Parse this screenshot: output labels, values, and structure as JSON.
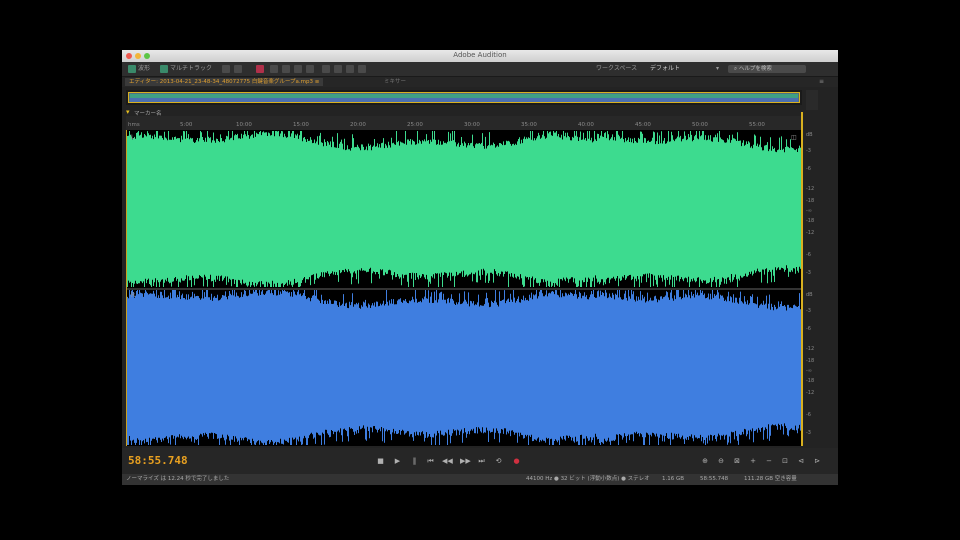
{
  "app": {
    "title": "Adobe Audition"
  },
  "toolbar": {
    "waveform_label": "波形",
    "multitrack_label": "マルチトラック",
    "workspace_label": "ワークスペース",
    "workspace_value": "デフォルト",
    "search_placeholder": "ヘルプを検索"
  },
  "tabs": [
    {
      "label": "エディター: 2013-04-21_23-48-34_48072775 白鍵音楽グループa.mp3 ≡"
    },
    {
      "label": "ミキサー"
    }
  ],
  "ruler": {
    "marker_label": "マーカー名",
    "ticks": [
      "hms",
      "5:00",
      "10:00",
      "15:00",
      "20:00",
      "25:00",
      "30:00",
      "35:00",
      "40:00",
      "45:00",
      "50:00",
      "55:00"
    ]
  },
  "channels": {
    "left": "L",
    "right": "R"
  },
  "db_scale": {
    "left": [
      "dB",
      "-3",
      "-6",
      "-12",
      "-18",
      "-∞",
      "-18",
      "-12",
      "-6",
      "-3"
    ],
    "right": [
      "dB",
      "-3",
      "-6",
      "-12",
      "-18",
      "-∞",
      "-18",
      "-12",
      "-6",
      "-3"
    ]
  },
  "colors": {
    "left_channel": "#3ddb8f",
    "right_channel": "#3f7ee0",
    "accent": "#e8a020"
  },
  "transport": {
    "time": "58:55.748",
    "buttons": [
      "stop-icon",
      "play-icon",
      "pause-icon",
      "loop-icon",
      "go-start-icon",
      "rewind-icon",
      "forward-icon",
      "go-end-icon",
      "record-icon"
    ]
  },
  "zoom": {
    "buttons": [
      "zoom-in-amplitude-icon",
      "zoom-out-amplitude-icon",
      "zoom-full-icon",
      "zoom-in-icon",
      "zoom-out-icon",
      "zoom-selection-icon",
      "zoom-in-left-icon",
      "zoom-in-right-icon"
    ]
  },
  "status": {
    "left": "ノーマライズ は 12.24 秒で完了しました",
    "format": "44100 Hz ● 32 ビット (浮動小数点) ● ステレオ",
    "size": "1.16 GB",
    "duration": "58:55.748",
    "free": "111.28 GB 空き容量"
  }
}
